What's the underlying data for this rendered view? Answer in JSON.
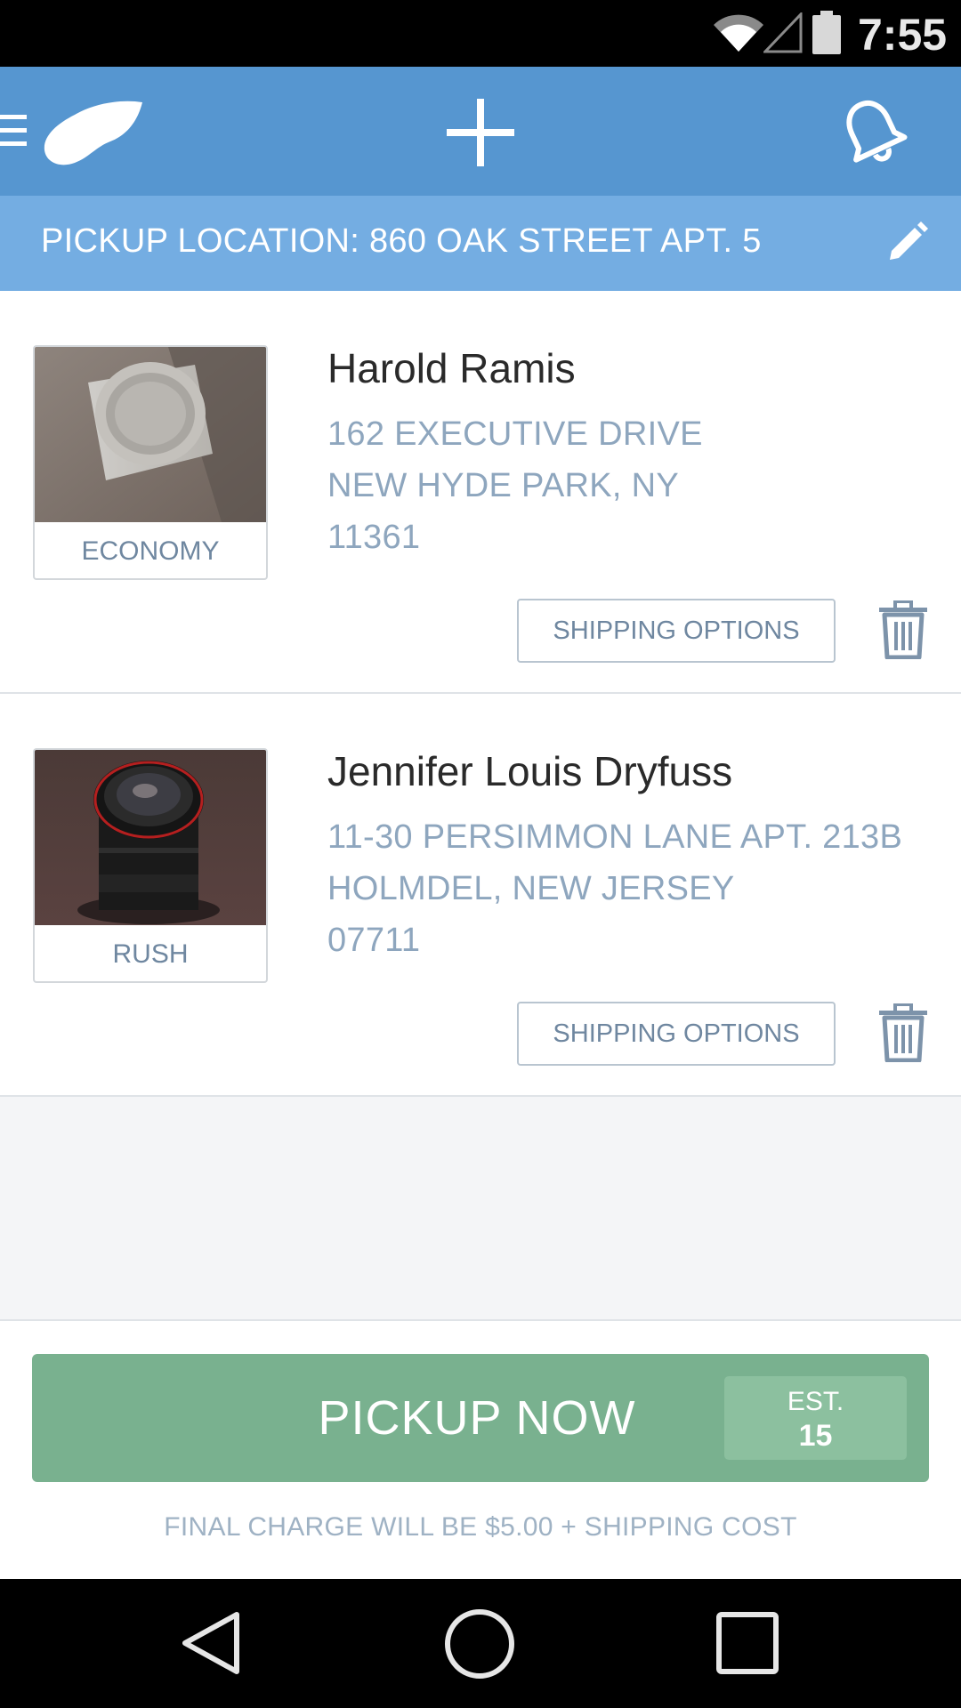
{
  "status_bar": {
    "time": "7:55",
    "icons": [
      "wifi-icon",
      "signal-icon",
      "battery-icon"
    ]
  },
  "app_bar": {
    "icons": [
      "menu-icon",
      "logo-wing-icon",
      "add-icon",
      "bell-icon"
    ],
    "accent_color": "#5696d0"
  },
  "pickup_location": {
    "text": "PICKUP LOCATION: 860 OAK STREET APT. 5",
    "edit_icon": "pencil-icon",
    "color": "#74ade2"
  },
  "shipments": [
    {
      "service": "ECONOMY",
      "name": "Harold Ramis",
      "address_line1": "162 EXECUTIVE DRIVE",
      "address_line2": "NEW HYDE PARK, NY",
      "zip": "11361",
      "shipping_button": "SHIPPING OPTIONS",
      "photo": "speaker-photo"
    },
    {
      "service": "RUSH",
      "name": "Jennifer Louis Dryfuss",
      "address_line1": "11-30 PERSIMMON LANE APT. 213B",
      "address_line2": "HOLMDEL, NEW JERSEY",
      "zip": "07711",
      "shipping_button": "SHIPPING OPTIONS",
      "photo": "camera-lens-photo"
    }
  ],
  "action": {
    "button_label": "PICKUP NOW",
    "est_label": "EST.",
    "est_value": "15",
    "button_color": "#79b18f",
    "note": "FINAL CHARGE WILL BE $5.00 + SHIPPING COST"
  },
  "nav_bar": {
    "icons": [
      "back-icon",
      "home-icon",
      "recents-icon"
    ]
  }
}
